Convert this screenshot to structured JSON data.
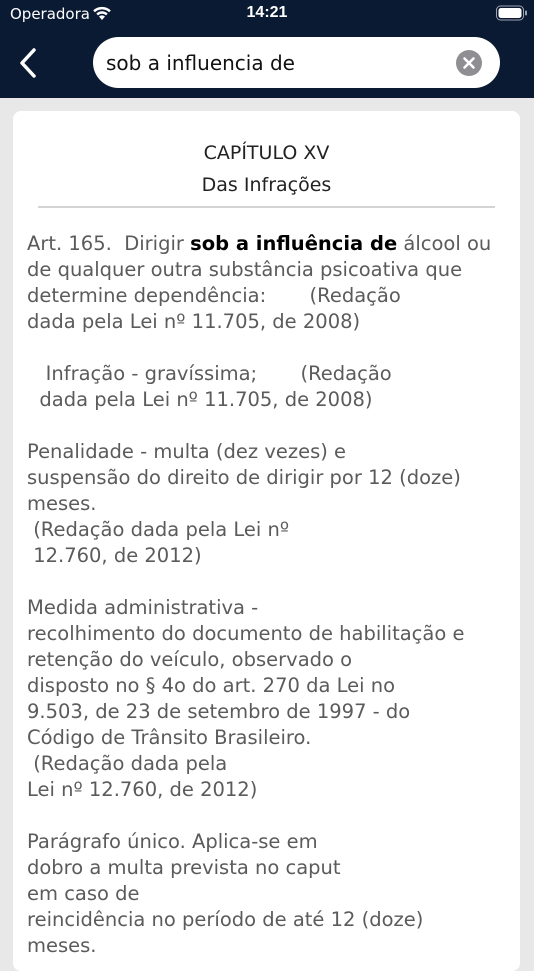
{
  "status_bar": {
    "carrier": "Operadora",
    "time": "14:21"
  },
  "search": {
    "value": "sob a influencia de"
  },
  "icons": {
    "back": "chevron-left-icon",
    "clear": "clear-circle-icon",
    "wifi": "wifi-icon",
    "battery": "battery-icon"
  },
  "colors": {
    "header_bg": "#0b1a33",
    "highlight": "#000000",
    "body_text": "#5b5b5b"
  },
  "article": {
    "chapter": "CAPÍTULO XV",
    "chapter_subtitle": "Das Infrações",
    "art_prefix": "Art. 165.  Dirigir ",
    "art_highlight": "sob a influência de",
    "art_line1_rest": " álcool ou",
    "art_line2": "de qualquer outra substância psicoativa que",
    "art_line3": "determine dependência:       (Redação",
    "art_line4": "dada pela Lei nº 11.705, de 2008)",
    "infracao_line1": "   Infração - gravíssima;       (Redação",
    "infracao_line2": "  dada pela Lei nº 11.705, de 2008)",
    "penalidade_line1": "Penalidade - multa (dez vezes) e",
    "penalidade_line2": "suspensão do direito de dirigir por 12 (doze)",
    "penalidade_line3": "meses.",
    "penalidade_line4": " (Redação dada pela Lei nº",
    "penalidade_line5": " 12.760, de 2012)",
    "medida_line1": "Medida administrativa -",
    "medida_line2": "recolhimento do documento de habilitação e",
    "medida_line3": "retenção do veículo, observado o",
    "medida_line4": "disposto no § 4o do art. 270 da Lei no",
    "medida_line5": "9.503, de 23 de setembro de 1997 - do",
    "medida_line6": "Código de Trânsito Brasileiro.",
    "medida_line7": " (Redação dada pela",
    "medida_line8": "Lei nº 12.760, de 2012)",
    "paragrafo_line1": "Parágrafo único. Aplica-se em",
    "paragrafo_line2": "dobro a multa prevista no caput",
    "paragrafo_line3": "em caso de",
    "paragrafo_line4": "reincidência no período de até 12 (doze)",
    "paragrafo_line5": "meses."
  }
}
